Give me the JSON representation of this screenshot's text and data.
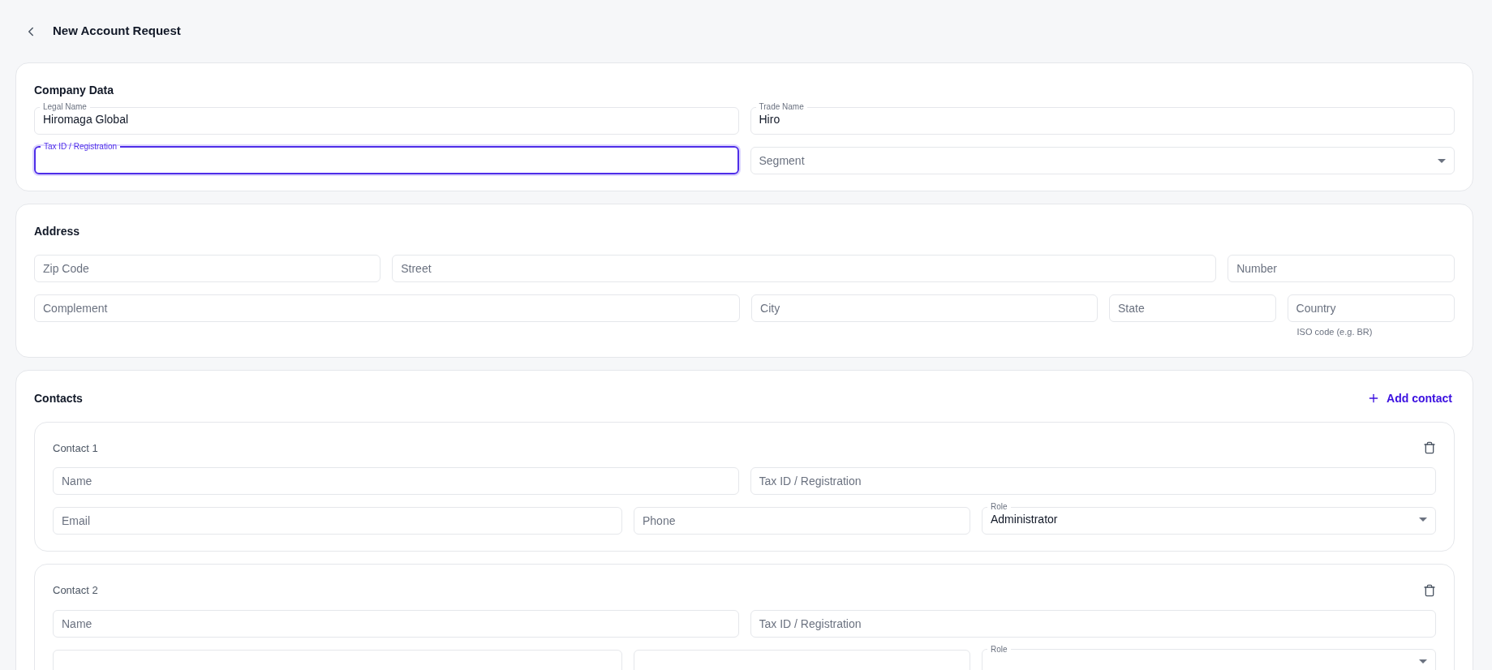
{
  "header": {
    "title": "New Account Request"
  },
  "company": {
    "title": "Company Data",
    "rows": [
      [
        {
          "kind": "text",
          "label": "Legal Name",
          "value": "Hiromaga Global",
          "focused": false
        },
        {
          "kind": "text",
          "label": "Trade Name",
          "value": "Hiro",
          "focused": false
        }
      ],
      [
        {
          "kind": "text",
          "label": "Tax ID / Registration",
          "focused": true
        },
        {
          "kind": "select",
          "placeholder": "Segment",
          "focused": false
        }
      ]
    ]
  },
  "address": {
    "title": "Address",
    "rows": [
      [
        {
          "kind": "text",
          "placeholder": "Zip Code",
          "focused": false
        },
        {
          "kind": "text",
          "placeholder": "Street",
          "focused": false
        },
        {
          "kind": "text",
          "placeholder": "Number",
          "focused": false
        }
      ],
      [
        {
          "kind": "text",
          "placeholder": "Complement",
          "focused": false
        },
        {
          "kind": "text",
          "placeholder": "City",
          "focused": false
        },
        {
          "kind": "text",
          "placeholder": "State",
          "focused": false
        },
        {
          "kind": "text",
          "placeholder": "Country",
          "helper": "ISO code (e.g. BR)",
          "focused": false
        }
      ]
    ]
  },
  "contacts": {
    "title": "Contacts",
    "add_label": "Add contact",
    "items": [
      {
        "title": "Contact 1",
        "rows": [
          [
            {
              "kind": "text",
              "placeholder": "Name",
              "focused": false
            },
            {
              "kind": "text",
              "placeholder": "Tax ID / Registration",
              "focused": false
            }
          ],
          [
            {
              "kind": "text",
              "placeholder": "Email",
              "focused": false
            },
            {
              "kind": "text",
              "placeholder": "Phone",
              "focused": false
            },
            {
              "kind": "select",
              "label": "Role",
              "value": "Administrator",
              "focused": false
            }
          ]
        ]
      },
      {
        "title": "Contact 2",
        "rows": [
          [
            {
              "kind": "text",
              "placeholder": "Name",
              "focused": false
            },
            {
              "kind": "text",
              "placeholder": "Tax ID / Registration",
              "focused": false
            }
          ],
          [
            {
              "kind": "text",
              "focused": false
            },
            {
              "kind": "text",
              "focused": false
            },
            {
              "kind": "select",
              "label": "Role",
              "focused": false
            }
          ]
        ]
      }
    ]
  }
}
